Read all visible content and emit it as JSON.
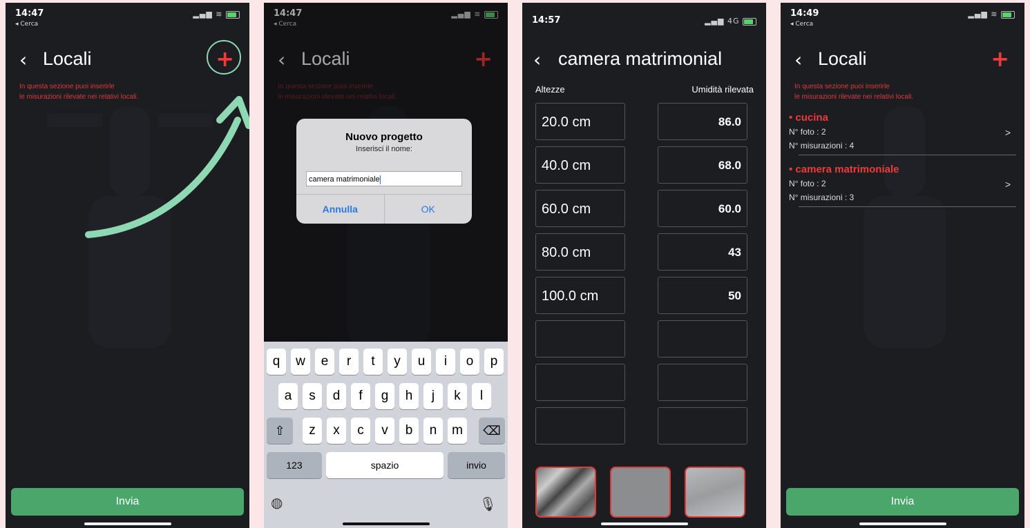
{
  "screen1": {
    "time": "14:47",
    "back_app": "◂ Cerca",
    "title": "Locali",
    "description": [
      "In questa sezione puoi inserirle",
      "le misurazioni rilevate nei relativi locali."
    ],
    "send_label": "Invia"
  },
  "screen2": {
    "time": "14:47",
    "back_app": "◂ Cerca",
    "title": "Locali",
    "description": [
      "In questa sezione puoi inserirle",
      "le misurazioni rilevate nei relativi locali."
    ],
    "dialog": {
      "title": "Nuovo progetto",
      "subtitle": "Inserisci il nome:",
      "input_value": "camera matrimoniale",
      "cancel_label": "Annulla",
      "ok_label": "OK"
    },
    "keyboard": {
      "row1": [
        "q",
        "w",
        "e",
        "r",
        "t",
        "y",
        "u",
        "i",
        "o",
        "p"
      ],
      "row2": [
        "a",
        "s",
        "d",
        "f",
        "g",
        "h",
        "j",
        "k",
        "l"
      ],
      "row3": [
        "z",
        "x",
        "c",
        "v",
        "b",
        "n",
        "m"
      ],
      "shift": "⇧",
      "delete": "⌫",
      "numbers": "123",
      "space": "spazio",
      "return": "invio"
    }
  },
  "screen3": {
    "time": "14:57",
    "network": "4G",
    "title": "camera matrimonial",
    "col_heights": "Altezze",
    "col_humidity": "Umidità rilevata",
    "rows": [
      {
        "height": "20.0 cm",
        "humidity": "86.0"
      },
      {
        "height": "40.0 cm",
        "humidity": "68.0"
      },
      {
        "height": "60.0 cm",
        "humidity": "60.0"
      },
      {
        "height": "80.0 cm",
        "humidity": "43"
      },
      {
        "height": "100.0 cm",
        "humidity": "50"
      },
      {
        "height": "",
        "humidity": ""
      },
      {
        "height": "",
        "humidity": ""
      },
      {
        "height": "",
        "humidity": ""
      }
    ]
  },
  "screen4": {
    "time": "14:49",
    "back_app": "◂ Cerca",
    "title": "Locali",
    "description": [
      "In questa sezione puoi inserirle",
      "le misurazioni rilevate nei relativi locali."
    ],
    "rooms": [
      {
        "name": "• cucina",
        "photos": "N° foto : 2",
        "measures": "N° misurazioni : 4"
      },
      {
        "name": "• camera matrimoniale",
        "photos": "N° foto : 2",
        "measures": "N° misurazioni : 3"
      }
    ],
    "row_arrow": ">",
    "send_label": "Invia"
  },
  "icons": {
    "back": "chevron-left-icon",
    "add": "plus-icon",
    "annotation": "curved-arrow-icon",
    "globe": "globe-icon",
    "mic": "microphone-icon"
  },
  "colors": {
    "accent_red": "#f0393a",
    "send_green": "#4aa66a",
    "annotation_mint": "#8fd8b4",
    "background": "#1c1d21",
    "canvas": "#fbe7e7"
  }
}
